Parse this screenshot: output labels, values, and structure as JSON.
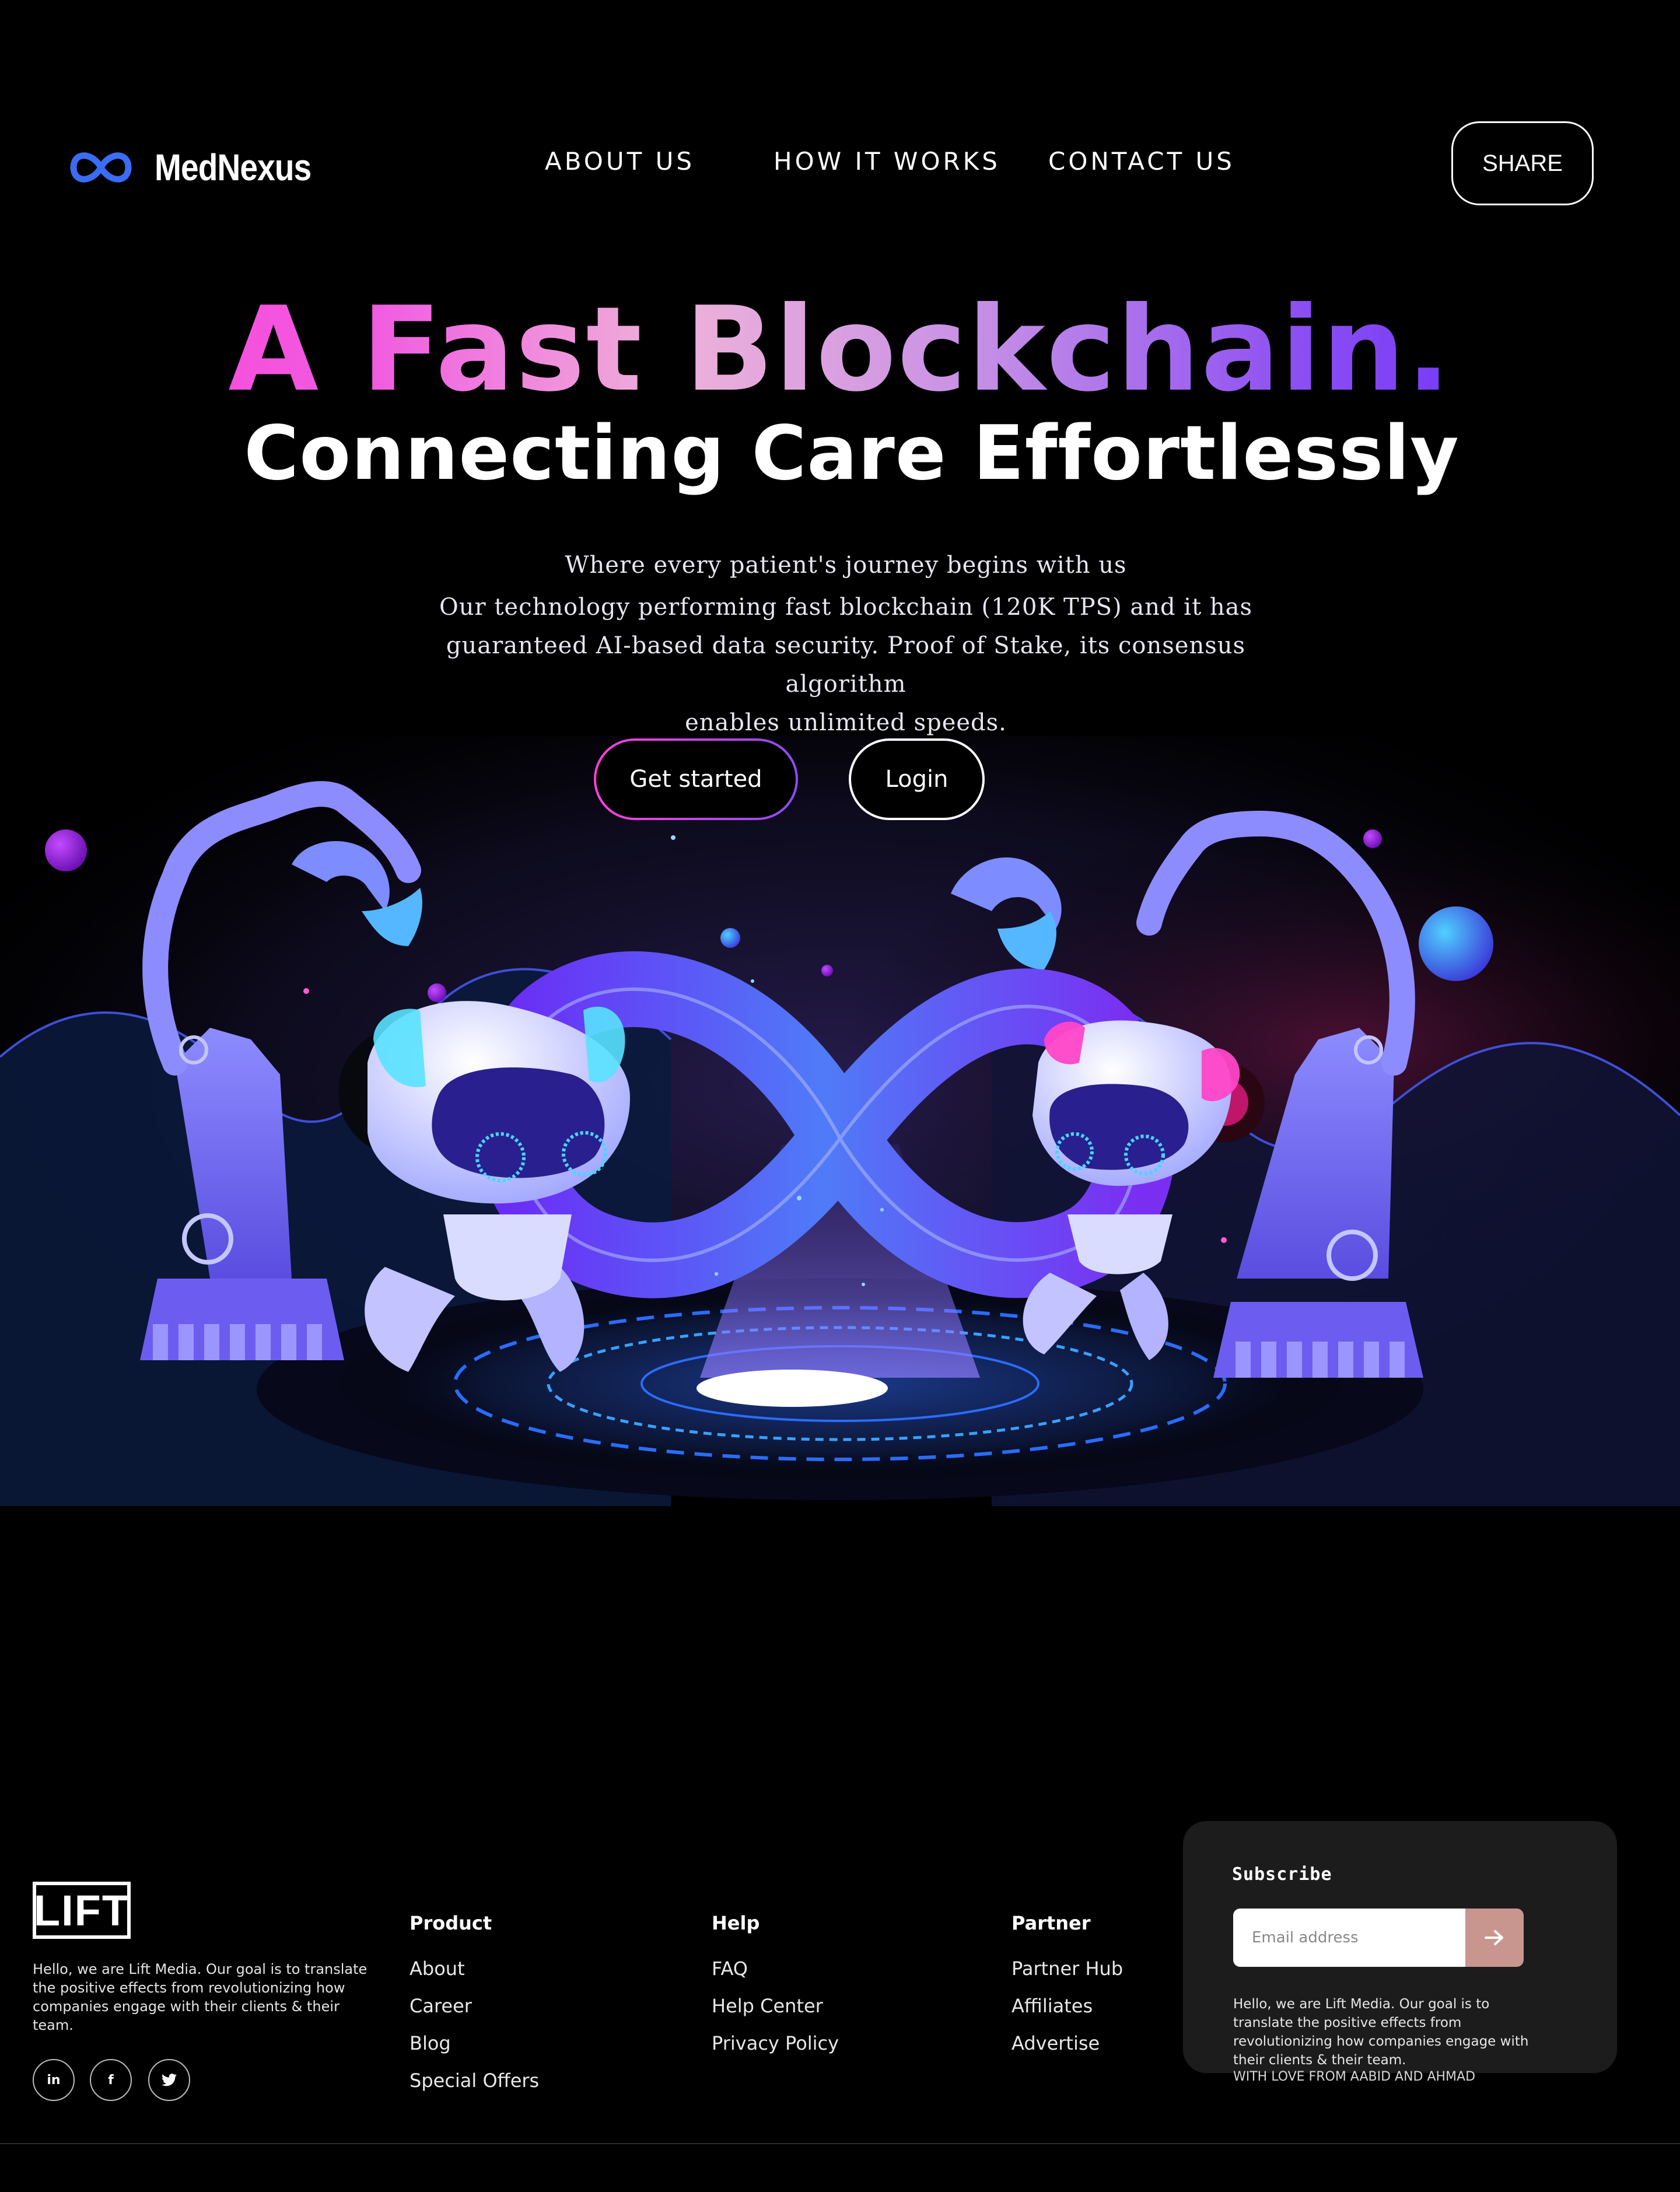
{
  "brand": {
    "name": "MedNexus",
    "icon": "infinity-logo-icon",
    "color": "#3a6cf4"
  },
  "nav": {
    "items": [
      {
        "label": "ABOUT US"
      },
      {
        "label": "HOW IT WORKS"
      },
      {
        "label": "CONTACT US"
      }
    ],
    "share_label": "SHARE"
  },
  "hero": {
    "title": "A Fast Blockchain.",
    "subtitle": "Connecting Care Effortlessly",
    "description": [
      "Where every patient's journey begins with us",
      "Our technology performing fast blockchain (120K TPS) and it has",
      "guaranteed AI-based data security. Proof of Stake, its consensus algorithm",
      "enables unlimited speeds."
    ],
    "primary_cta": "Get started",
    "secondary_cta": "Login",
    "illustration": "robots-infinity-illustration",
    "gradient_colors": [
      "#ff3fd9",
      "#efb2d9",
      "#8a4df2",
      "#5a20ff"
    ]
  },
  "footer": {
    "logo_text": "LIFT",
    "about": "Hello, we are Lift Media. Our goal is to translate the positive effects from revolutionizing how companies engage with their clients & their team.",
    "social": [
      {
        "icon": "linkedin-icon",
        "glyph": "in"
      },
      {
        "icon": "facebook-icon",
        "glyph": "f"
      },
      {
        "icon": "twitter-icon",
        "glyph": "t"
      }
    ],
    "columns": [
      {
        "heading": "Product",
        "links": [
          "About",
          "Career",
          "Blog",
          "Special Offers"
        ]
      },
      {
        "heading": "Help",
        "links": [
          "FAQ",
          "Help Center",
          "Privacy Policy"
        ]
      },
      {
        "heading": "Partner",
        "links": [
          "Partner Hub",
          "Affiliates",
          "Advertise"
        ]
      }
    ],
    "subscribe": {
      "title": "Subscribe",
      "placeholder": "Email address",
      "button_icon": "arrow-right-icon",
      "text": "Hello, we are Lift Media. Our goal is to translate the positive effects from revolutionizing how companies engage with their clients & their team.",
      "credit": "WITH LOVE FROM AABID AND AHMAD"
    }
  }
}
